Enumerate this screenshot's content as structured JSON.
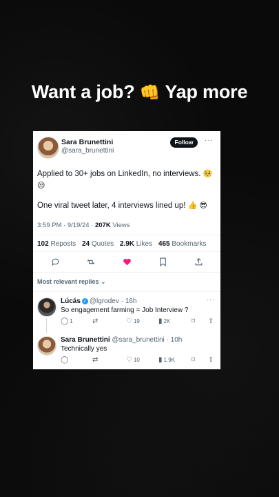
{
  "headline": {
    "text_before": "Want a job?",
    "emoji": "👊",
    "text_after": "Yap more"
  },
  "tweet": {
    "name": "Sara Brunettini",
    "handle": "@sara_brunettini",
    "follow_label": "Follow",
    "more": "···",
    "line1_text": "Applied to 30+ jobs on LinkedIn, no interviews.",
    "line1_emoji_a": "🥺",
    "line1_emoji_b": "😒",
    "line2_text": "One viral tweet later, 4 interviews lined up!",
    "line2_emoji_a": "👍",
    "line2_emoji_b": "😎",
    "time": "3:59 PM · 9/19/24 · ",
    "views_count": "207K",
    "views_label": " Views",
    "reposts_count": "102",
    "reposts_label": " Reposts",
    "quotes_count": "24",
    "quotes_label": " Quotes",
    "likes_count": "2.9K",
    "likes_label": " Likes",
    "bookmarks_count": "465",
    "bookmarks_label": " Bookmarks",
    "like_color": "#f91880"
  },
  "sort_label": "Most relevant replies ⌄",
  "replies": [
    {
      "name": "Lúcás",
      "handle": "@lgrodev",
      "time": " · 16h",
      "text": "So engagement farming = Job Interview ?",
      "replies": "1",
      "likes": "19",
      "views": "2K"
    },
    {
      "name": "Sara Brunettini",
      "handle": "@sara_brunettini",
      "time": " · 10h",
      "text": "Technically yes",
      "replies": "",
      "likes": "10",
      "views": "1.9K"
    }
  ]
}
